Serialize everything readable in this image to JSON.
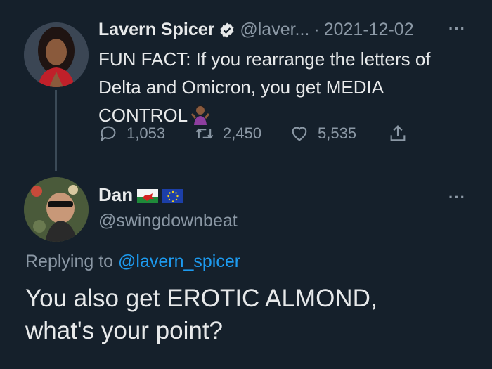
{
  "tweet": {
    "author_name": "Lavern Spicer",
    "author_handle": "@laver...",
    "dot": "·",
    "date": "2021-12-02",
    "more": "···",
    "text_line1": "FUN FACT: If you rearrange the letters of",
    "text_line2": "Delta and Omicron, you get MEDIA",
    "text_line3": "CONTROL",
    "reply_count": "1,053",
    "retweet_count": "2,450",
    "like_count": "5,535",
    "icons": {
      "verified": "verified-badge-icon",
      "emoji": "person-shrugging-emoji",
      "reply": "reply-icon",
      "retweet": "retweet-icon",
      "like": "heart-icon",
      "share": "share-icon"
    }
  },
  "reply": {
    "author_name": "Dan",
    "author_handle": "@swingdownbeat",
    "more": "···",
    "replying_prefix": "Replying to",
    "replying_to": "@lavern_spicer",
    "text_line1": "You also get EROTIC ALMOND,",
    "text_line2": "what's your point?",
    "flags": [
      "wales-flag",
      "eu-flag"
    ]
  },
  "colors": {
    "background": "#15202b",
    "text": "#e7e9ea",
    "muted": "#8b98a5",
    "link": "#1d9bf0"
  }
}
